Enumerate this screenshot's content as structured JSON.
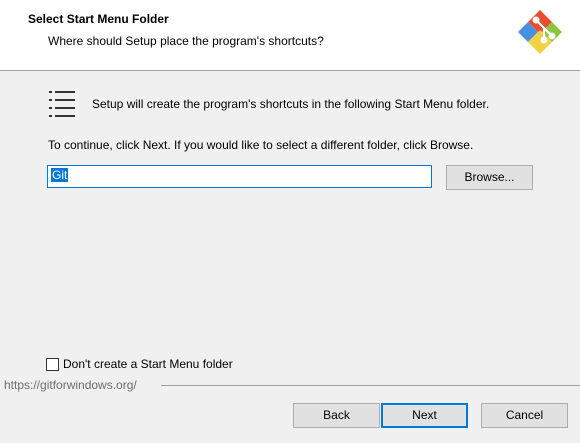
{
  "header": {
    "title": "Select Start Menu Folder",
    "subtitle": "Where should Setup place the program's shortcuts?",
    "logo_icon": "git-logo-icon"
  },
  "main": {
    "list_icon": "list-icon",
    "info_text": "Setup will create the program's shortcuts in the following Start Menu folder.",
    "continue_text": "To continue, click Next. If you would like to select a different folder, click Browse.",
    "folder_value": "Git",
    "browse_label": "Browse..."
  },
  "options": {
    "no_start_menu_label": "Don't create a Start Menu folder",
    "no_start_menu_checked": false
  },
  "footer": {
    "url_text": "https://gitforwindows.org/",
    "back_label": "Back",
    "next_label": "Next",
    "cancel_label": "Cancel"
  },
  "colors": {
    "accent": "#0078d7",
    "logo_red": "#e94e31",
    "logo_green": "#8cc63f",
    "logo_blue": "#4a90e2",
    "logo_yellow": "#f2d245"
  }
}
